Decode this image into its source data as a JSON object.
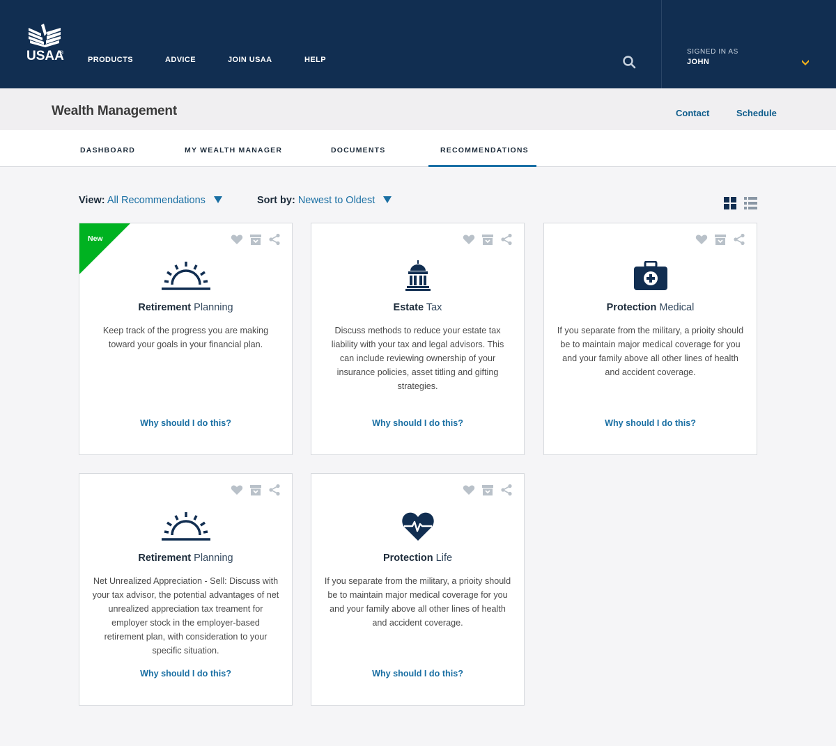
{
  "header": {
    "logo_text": "USAA",
    "logo_reg": "®",
    "nav": [
      "PRODUCTS",
      "ADVICE",
      "JOIN USAA",
      "HELP"
    ],
    "signed_in_label": "SIGNED IN AS",
    "user_name": "JOHN",
    "colors": {
      "background": "#112e51",
      "chevron": "#f5b21a"
    }
  },
  "subheader": {
    "title": "Wealth Management",
    "links": [
      "Contact",
      "Schedule"
    ]
  },
  "tabs": {
    "items": [
      "DASHBOARD",
      "MY WEALTH MANAGER",
      "DOCUMENTS",
      "RECOMMENDATIONS"
    ],
    "active": "RECOMMENDATIONS"
  },
  "toolbar": {
    "view_label": "View:",
    "view_value": "All Recommendations",
    "sort_label": "Sort by:",
    "sort_value": "Newest to Oldest",
    "layout_mode": "grid"
  },
  "cards": [
    {
      "badge": "New",
      "icon": "sunrise-icon",
      "title_bold": "Retirement",
      "title_rest": "Planning",
      "description": "Keep track of the progress you are making toward your goals in your financial plan.",
      "link": "Why should I do this?"
    },
    {
      "icon": "capitol-building-icon",
      "title_bold": "Estate",
      "title_rest": "Tax",
      "description": "Discuss methods to reduce your estate tax liability with your tax and legal advisors. This can include reviewing ownership of your insurance policies, asset titling and gifting strategies.",
      "link": "Why should I do this?"
    },
    {
      "icon": "medical-kit-icon",
      "title_bold": "Protection",
      "title_rest": "Medical",
      "description": "If you separate from the military, a prioity should be to maintain major medical coverage for you and your family above all other lines of health and accident coverage.",
      "link": "Why should I do this?"
    },
    {
      "icon": "sunrise-icon",
      "title_bold": "Retirement",
      "title_rest": "Planning",
      "description": "Net Unrealized Appreciation - Sell: Discuss with your tax advisor, the potential advantages of net unrealized appreciation tax treament for employer stock in the employer-based retirement plan, with consideration to your specific situation.",
      "link": "Why should I do this?"
    },
    {
      "icon": "heart-pulse-icon",
      "title_bold": "Protection",
      "title_rest": "Life",
      "description": "If you separate from the military, a prioity should be to maintain major medical coverage for you and your family above all other lines of health and accident coverage.",
      "link": "Why should I do this?"
    }
  ],
  "colors": {
    "accent": "#1a6fa3",
    "icon_navy": "#112e51",
    "badge_green": "#00b221",
    "action_icon_gray": "#b9c1c9"
  }
}
